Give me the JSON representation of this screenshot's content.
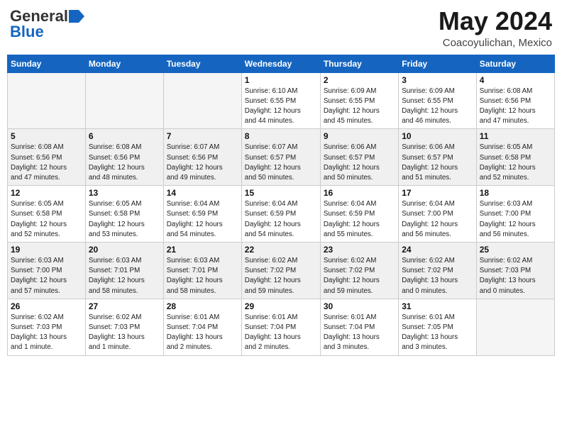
{
  "header": {
    "logo_general": "General",
    "logo_blue": "Blue",
    "month_title": "May 2024",
    "location": "Coacoyulichan, Mexico"
  },
  "days_of_week": [
    "Sunday",
    "Monday",
    "Tuesday",
    "Wednesday",
    "Thursday",
    "Friday",
    "Saturday"
  ],
  "weeks": [
    [
      {
        "day": "",
        "info": ""
      },
      {
        "day": "",
        "info": ""
      },
      {
        "day": "",
        "info": ""
      },
      {
        "day": "1",
        "info": "Sunrise: 6:10 AM\nSunset: 6:55 PM\nDaylight: 12 hours\nand 44 minutes."
      },
      {
        "day": "2",
        "info": "Sunrise: 6:09 AM\nSunset: 6:55 PM\nDaylight: 12 hours\nand 45 minutes."
      },
      {
        "day": "3",
        "info": "Sunrise: 6:09 AM\nSunset: 6:55 PM\nDaylight: 12 hours\nand 46 minutes."
      },
      {
        "day": "4",
        "info": "Sunrise: 6:08 AM\nSunset: 6:56 PM\nDaylight: 12 hours\nand 47 minutes."
      }
    ],
    [
      {
        "day": "5",
        "info": "Sunrise: 6:08 AM\nSunset: 6:56 PM\nDaylight: 12 hours\nand 47 minutes."
      },
      {
        "day": "6",
        "info": "Sunrise: 6:08 AM\nSunset: 6:56 PM\nDaylight: 12 hours\nand 48 minutes."
      },
      {
        "day": "7",
        "info": "Sunrise: 6:07 AM\nSunset: 6:56 PM\nDaylight: 12 hours\nand 49 minutes."
      },
      {
        "day": "8",
        "info": "Sunrise: 6:07 AM\nSunset: 6:57 PM\nDaylight: 12 hours\nand 50 minutes."
      },
      {
        "day": "9",
        "info": "Sunrise: 6:06 AM\nSunset: 6:57 PM\nDaylight: 12 hours\nand 50 minutes."
      },
      {
        "day": "10",
        "info": "Sunrise: 6:06 AM\nSunset: 6:57 PM\nDaylight: 12 hours\nand 51 minutes."
      },
      {
        "day": "11",
        "info": "Sunrise: 6:05 AM\nSunset: 6:58 PM\nDaylight: 12 hours\nand 52 minutes."
      }
    ],
    [
      {
        "day": "12",
        "info": "Sunrise: 6:05 AM\nSunset: 6:58 PM\nDaylight: 12 hours\nand 52 minutes."
      },
      {
        "day": "13",
        "info": "Sunrise: 6:05 AM\nSunset: 6:58 PM\nDaylight: 12 hours\nand 53 minutes."
      },
      {
        "day": "14",
        "info": "Sunrise: 6:04 AM\nSunset: 6:59 PM\nDaylight: 12 hours\nand 54 minutes."
      },
      {
        "day": "15",
        "info": "Sunrise: 6:04 AM\nSunset: 6:59 PM\nDaylight: 12 hours\nand 54 minutes."
      },
      {
        "day": "16",
        "info": "Sunrise: 6:04 AM\nSunset: 6:59 PM\nDaylight: 12 hours\nand 55 minutes."
      },
      {
        "day": "17",
        "info": "Sunrise: 6:04 AM\nSunset: 7:00 PM\nDaylight: 12 hours\nand 56 minutes."
      },
      {
        "day": "18",
        "info": "Sunrise: 6:03 AM\nSunset: 7:00 PM\nDaylight: 12 hours\nand 56 minutes."
      }
    ],
    [
      {
        "day": "19",
        "info": "Sunrise: 6:03 AM\nSunset: 7:00 PM\nDaylight: 12 hours\nand 57 minutes."
      },
      {
        "day": "20",
        "info": "Sunrise: 6:03 AM\nSunset: 7:01 PM\nDaylight: 12 hours\nand 58 minutes."
      },
      {
        "day": "21",
        "info": "Sunrise: 6:03 AM\nSunset: 7:01 PM\nDaylight: 12 hours\nand 58 minutes."
      },
      {
        "day": "22",
        "info": "Sunrise: 6:02 AM\nSunset: 7:02 PM\nDaylight: 12 hours\nand 59 minutes."
      },
      {
        "day": "23",
        "info": "Sunrise: 6:02 AM\nSunset: 7:02 PM\nDaylight: 12 hours\nand 59 minutes."
      },
      {
        "day": "24",
        "info": "Sunrise: 6:02 AM\nSunset: 7:02 PM\nDaylight: 13 hours\nand 0 minutes."
      },
      {
        "day": "25",
        "info": "Sunrise: 6:02 AM\nSunset: 7:03 PM\nDaylight: 13 hours\nand 0 minutes."
      }
    ],
    [
      {
        "day": "26",
        "info": "Sunrise: 6:02 AM\nSunset: 7:03 PM\nDaylight: 13 hours\nand 1 minute."
      },
      {
        "day": "27",
        "info": "Sunrise: 6:02 AM\nSunset: 7:03 PM\nDaylight: 13 hours\nand 1 minute."
      },
      {
        "day": "28",
        "info": "Sunrise: 6:01 AM\nSunset: 7:04 PM\nDaylight: 13 hours\nand 2 minutes."
      },
      {
        "day": "29",
        "info": "Sunrise: 6:01 AM\nSunset: 7:04 PM\nDaylight: 13 hours\nand 2 minutes."
      },
      {
        "day": "30",
        "info": "Sunrise: 6:01 AM\nSunset: 7:04 PM\nDaylight: 13 hours\nand 3 minutes."
      },
      {
        "day": "31",
        "info": "Sunrise: 6:01 AM\nSunset: 7:05 PM\nDaylight: 13 hours\nand 3 minutes."
      },
      {
        "day": "",
        "info": ""
      }
    ]
  ]
}
